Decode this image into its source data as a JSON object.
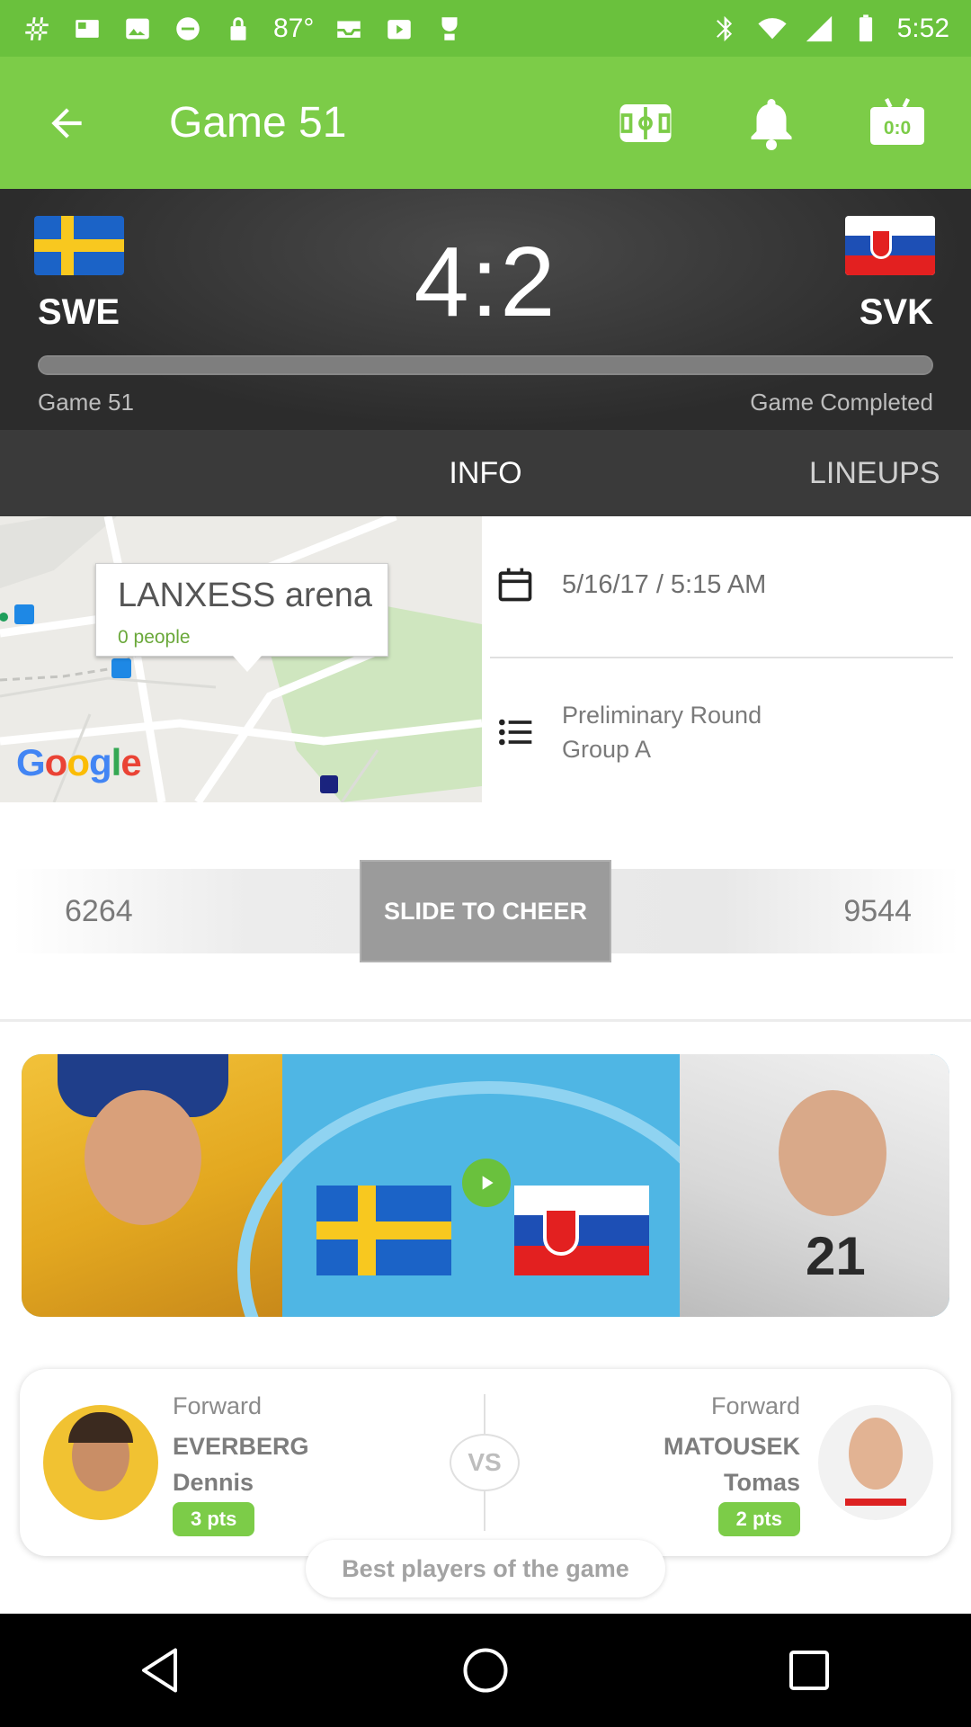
{
  "status_bar": {
    "temperature": "87°",
    "time": "5:52",
    "icons": [
      "hashtag-icon",
      "news-icon",
      "image-icon",
      "no-disturb-icon",
      "lock-icon",
      "temperature",
      "inbox-icon",
      "play-store-icon",
      "game-icon",
      "bluetooth-icon",
      "wifi-icon",
      "cellular-icon",
      "battery-icon"
    ]
  },
  "app_bar": {
    "title": "Game 51",
    "back_icon": "arrow-left-icon",
    "actions": [
      "field-icon",
      "bell-icon",
      "scoreboard-icon"
    ]
  },
  "match": {
    "home_code": "SWE",
    "away_code": "SVK",
    "score": "4:2",
    "game_label": "Game 51",
    "status": "Game Completed",
    "progress": 1.0
  },
  "tabs": {
    "info": "INFO",
    "lineups": "LINEUPS",
    "selected": "INFO"
  },
  "info": {
    "venue_name": "LANXESS arena",
    "venue_people": "0 people",
    "map_brand": [
      "G",
      "o",
      "o",
      "g",
      "l",
      "e"
    ],
    "date_time": "5/16/17 / 5:15 AM",
    "round_line1": "Preliminary Round",
    "round_line2": "Group A"
  },
  "cheer": {
    "left_count": "6264",
    "right_count": "9544",
    "button_label": "SLIDE TO CHEER"
  },
  "best_players": {
    "left": {
      "position": "Forward",
      "last_name": "EVERBERG",
      "first_name": "Dennis",
      "points": "3 pts"
    },
    "right": {
      "position": "Forward",
      "last_name": "MATOUSEK",
      "first_name": "Tomas",
      "points": "2 pts"
    },
    "vs": "VS",
    "label": "Best players of the game"
  },
  "colors": {
    "status_bar": "#6ac13d",
    "app_bar": "#7ccc48",
    "header_dark": "#2c2c2c",
    "tab_bar": "#3a3a3a",
    "accent_green": "#7ccc48"
  }
}
